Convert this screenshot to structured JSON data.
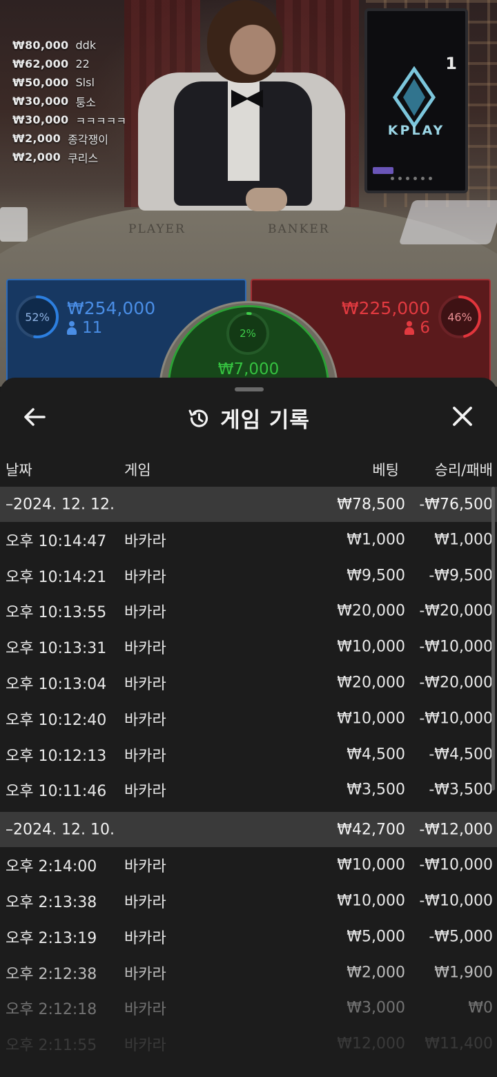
{
  "stream": {
    "table_labels": {
      "player": "PLAYER",
      "banker": "BANKER"
    },
    "monitor": {
      "round_number": "1",
      "brand": "KPLAY"
    }
  },
  "winners": [
    {
      "amount": "₩80,000",
      "name": "ddk"
    },
    {
      "amount": "₩62,000",
      "name": "22"
    },
    {
      "amount": "₩50,000",
      "name": "Slsl"
    },
    {
      "amount": "₩30,000",
      "name": "퉁소"
    },
    {
      "amount": "₩30,000",
      "name": "ㅋㅋㅋㅋㅋ"
    },
    {
      "amount": "₩2,000",
      "name": "종각쟁이"
    },
    {
      "amount": "₩2,000",
      "name": "쿠리스"
    }
  ],
  "bets": {
    "player": {
      "percent": "52%",
      "percent_value": 52,
      "amount": "₩254,000",
      "players": "11",
      "color": "#2e6bb8"
    },
    "banker": {
      "percent": "46%",
      "percent_value": 46,
      "amount": "₩225,000",
      "players": "6",
      "color": "#a53035"
    },
    "tie": {
      "percent": "2%",
      "percent_value": 2,
      "amount": "₩7,000",
      "color": "#2ca236"
    }
  },
  "history": {
    "title": "게임 기록",
    "icons": {
      "back": "arrow-left-icon",
      "title": "history-icon",
      "close": "close-icon"
    },
    "columns": {
      "date": "날짜",
      "game": "게임",
      "bet": "베팅",
      "result": "승리/패배"
    },
    "groups": [
      {
        "date": "–2024. 12. 12.",
        "bet": "₩78,500",
        "result": "-₩76,500",
        "rows": [
          {
            "time": "오후 10:14:47",
            "game": "바카라",
            "bet": "₩1,000",
            "result": "₩1,000"
          },
          {
            "time": "오후 10:14:21",
            "game": "바카라",
            "bet": "₩9,500",
            "result": "-₩9,500"
          },
          {
            "time": "오후 10:13:55",
            "game": "바카라",
            "bet": "₩20,000",
            "result": "-₩20,000"
          },
          {
            "time": "오후 10:13:31",
            "game": "바카라",
            "bet": "₩10,000",
            "result": "-₩10,000"
          },
          {
            "time": "오후 10:13:04",
            "game": "바카라",
            "bet": "₩20,000",
            "result": "-₩20,000"
          },
          {
            "time": "오후 10:12:40",
            "game": "바카라",
            "bet": "₩10,000",
            "result": "-₩10,000"
          },
          {
            "time": "오후 10:12:13",
            "game": "바카라",
            "bet": "₩4,500",
            "result": "-₩4,500"
          },
          {
            "time": "오후 10:11:46",
            "game": "바카라",
            "bet": "₩3,500",
            "result": "-₩3,500"
          }
        ]
      },
      {
        "date": "–2024. 12. 10.",
        "bet": "₩42,700",
        "result": "-₩12,000",
        "rows": [
          {
            "time": "오후 2:14:00",
            "game": "바카라",
            "bet": "₩10,000",
            "result": "-₩10,000"
          },
          {
            "time": "오후 2:13:38",
            "game": "바카라",
            "bet": "₩10,000",
            "result": "-₩10,000"
          },
          {
            "time": "오후 2:13:19",
            "game": "바카라",
            "bet": "₩5,000",
            "result": "-₩5,000"
          },
          {
            "time": "오후 2:12:38",
            "game": "바카라",
            "bet": "₩2,000",
            "result": "₩1,900"
          },
          {
            "time": "오후 2:12:18",
            "game": "바카라",
            "bet": "₩3,000",
            "result": "₩0"
          },
          {
            "time": "오후 2:11:55",
            "game": "바카라",
            "bet": "₩12,000",
            "result": "₩11,400"
          }
        ]
      }
    ]
  }
}
